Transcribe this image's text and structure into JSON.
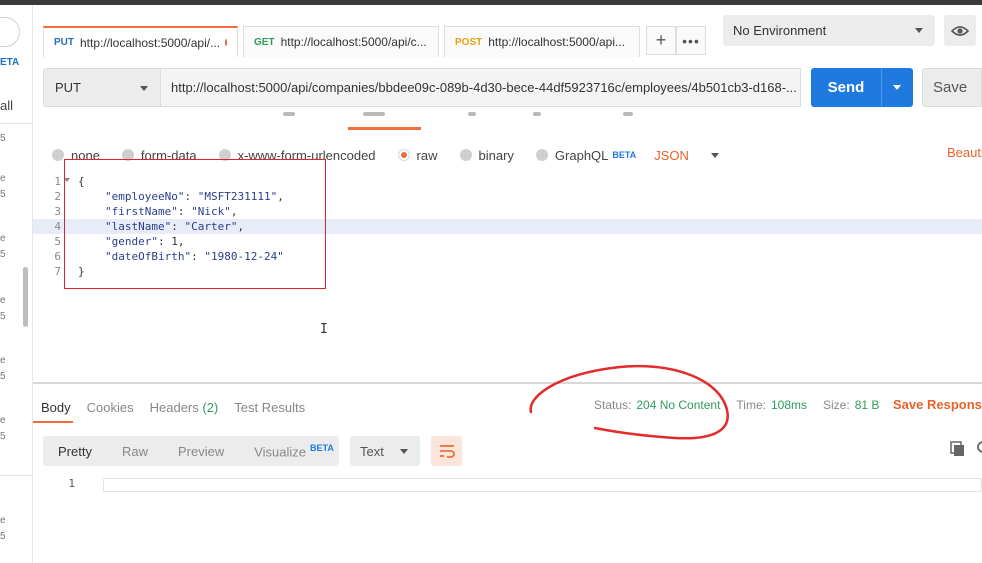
{
  "tabs": [
    {
      "method": "PUT",
      "url": "http://localhost:5000/api/...",
      "method_color": "#2a6bbf"
    },
    {
      "method": "GET",
      "url": "http://localhost:5000/api/c...",
      "method_color": "#2e9c5a"
    },
    {
      "method": "POST",
      "url": "http://localhost:5000/api...",
      "method_color": "#e6a012"
    }
  ],
  "environment": "No Environment",
  "request": {
    "method": "PUT",
    "url": "http://localhost:5000/api/companies/bbdee09c-089b-4d30-bece-44df5923716c/employees/4b501cb3-d168-...",
    "send_label": "Send",
    "save_label": "Save"
  },
  "body_types": {
    "none": "none",
    "form_data": "form-data",
    "urlencoded": "x-www-form-urlencoded",
    "raw": "raw",
    "binary": "binary",
    "graphql": "GraphQL",
    "beta": "BETA",
    "format": "JSON",
    "beautify": "Beauti"
  },
  "editor": {
    "line_numbers": [
      "1",
      "2",
      "3",
      "4",
      "5",
      "6",
      "7"
    ],
    "open_brace": "{",
    "close_brace": "}",
    "fields": [
      {
        "key": "\"employeeNo\"",
        "value": "\"MSFT231111\""
      },
      {
        "key": "\"firstName\"",
        "value": "\"Nick\""
      },
      {
        "key": "\"lastName\"",
        "value": "\"Carter\""
      },
      {
        "key": "\"gender\"",
        "value": "1"
      },
      {
        "key": "\"dateOfBirth\"",
        "value": "\"1980-12-24\""
      }
    ]
  },
  "response": {
    "tabs": {
      "body": "Body",
      "cookies": "Cookies",
      "headers": "Headers",
      "headers_count": "(2)",
      "tests": "Test Results"
    },
    "status_label": "Status:",
    "status_value": "204 No Content",
    "time_label": "Time:",
    "time_value": "108ms",
    "size_label": "Size:",
    "size_value": "81 B",
    "save_response": "Save Response",
    "views": {
      "pretty": "Pretty",
      "raw": "Raw",
      "preview": "Preview",
      "visualize": "Visualize",
      "beta": "BETA"
    },
    "format": "Text",
    "line_number": "1"
  },
  "sidebar": {
    "beta": "ETA",
    "all": "all"
  },
  "colors": {
    "accent": "#f26b3a",
    "send": "#1f7ae0",
    "success": "#2e9c5a",
    "annotation": "#d9282f"
  }
}
